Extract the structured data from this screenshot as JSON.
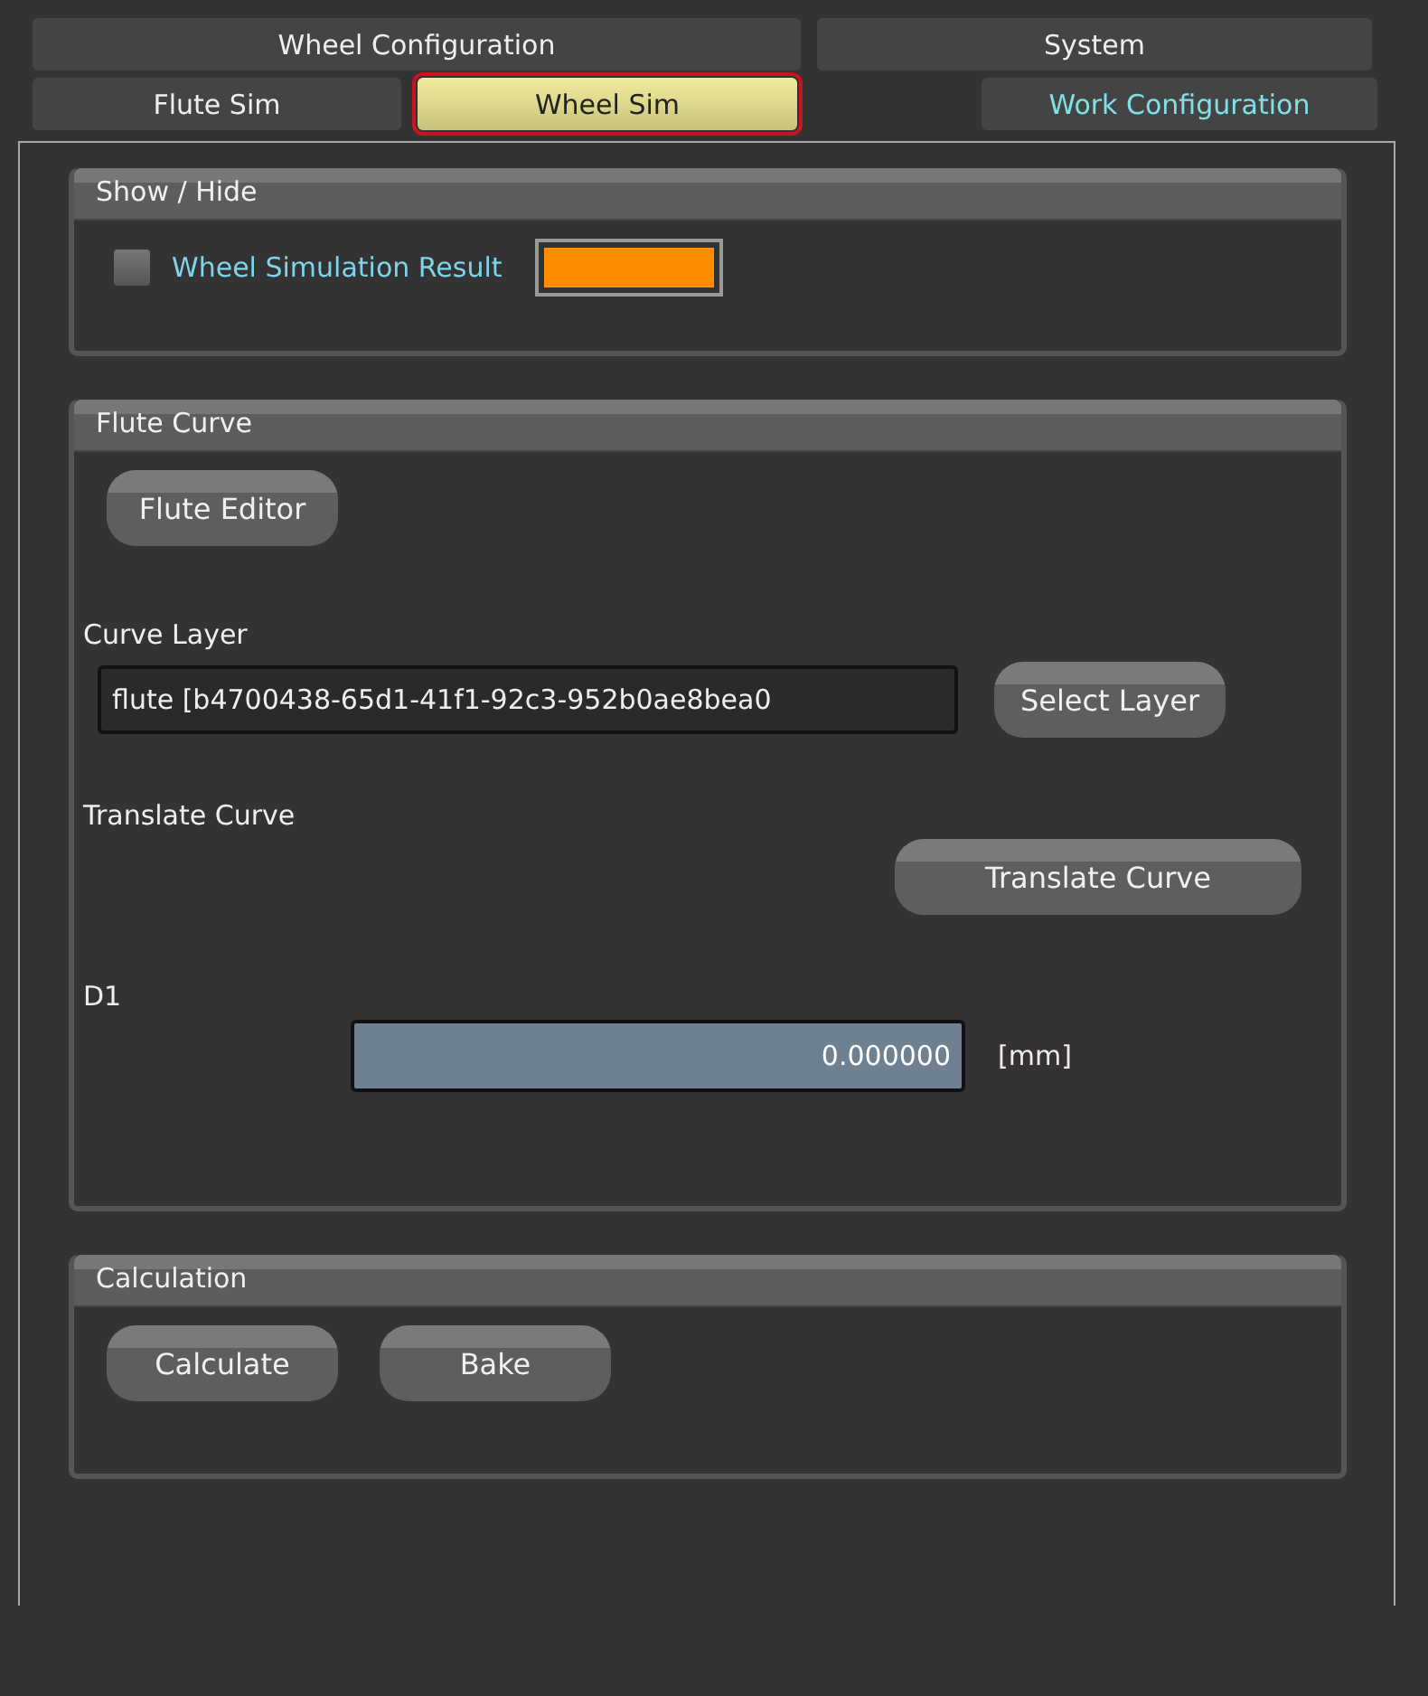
{
  "tab_rows": [
    [
      {
        "label": "Wheel Configuration",
        "selected": false,
        "kind": "plain"
      },
      {
        "label": "System",
        "selected": false,
        "kind": "plain"
      }
    ],
    [
      {
        "label": "Flute Sim",
        "selected": false,
        "kind": "plain"
      },
      {
        "label": "Wheel Sim",
        "selected": true,
        "kind": "plain"
      },
      {
        "label": "Work Configuration",
        "selected": false,
        "kind": "accent"
      }
    ]
  ],
  "show_hide": {
    "title": "Show / Hide",
    "option": {
      "label": "Wheel Simulation Result",
      "checked": false,
      "color": "#ff8c00"
    }
  },
  "flute_curve": {
    "title": "Flute Curve",
    "editor_button": "Flute Editor",
    "curve_layer": {
      "label": "Curve Layer",
      "value": "flute [b4700438-65d1-41f1-92c3-952b0ae8bea0",
      "button": "Select Layer"
    },
    "translate": {
      "label": "Translate Curve",
      "button": "Translate Curve"
    },
    "d1": {
      "label": "D1",
      "value": "0.000000",
      "unit": "[mm]"
    }
  },
  "calculation": {
    "title": "Calculation",
    "buttons": [
      "Calculate",
      "Bake"
    ]
  }
}
